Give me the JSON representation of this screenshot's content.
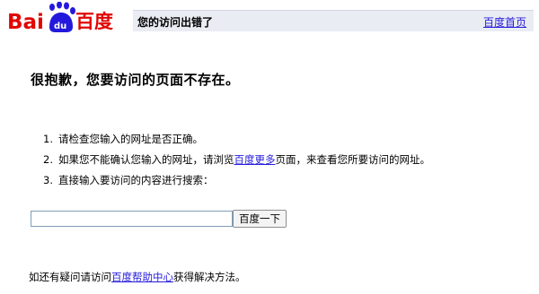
{
  "logo": {
    "text": "Bai du 百度"
  },
  "header": {
    "title": "您的访问出错了",
    "home_link": "百度首页"
  },
  "error": {
    "headline": "很抱歉，您要访问的页面不存在。"
  },
  "tips": [
    {
      "number": "1.",
      "text": "请检查您输入的网址是否正确。"
    },
    {
      "number": "2.",
      "before": "如果您不能确认您输入的网址，请浏览",
      "link": "百度更多",
      "after": "页面，来查看您所要访问的网址。"
    },
    {
      "number": "3.",
      "text": "直接输入要访问的内容进行搜索："
    }
  ],
  "search": {
    "value": "",
    "placeholder": "",
    "button": "百度一下"
  },
  "footer": {
    "before": "如还有疑问请访问",
    "link": "百度帮助中心",
    "after": "获得解决方法。"
  },
  "colors": {
    "logo_red": "#e10602",
    "logo_blue": "#2319dc",
    "link": "#261cdc",
    "header_bg": "#e9ecf3"
  }
}
